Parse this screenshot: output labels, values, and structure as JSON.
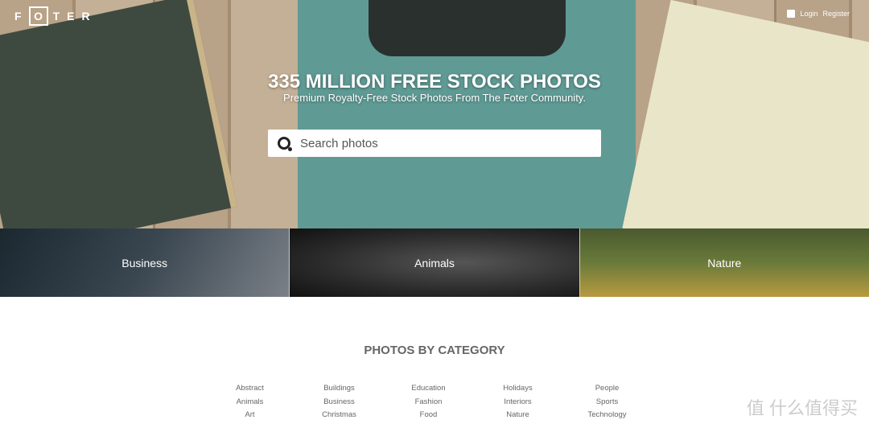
{
  "header": {
    "logo": "FOTER",
    "login": "Login",
    "register": "Register"
  },
  "hero": {
    "title": "335 MILLION FREE STOCK PHOTOS",
    "subtitle": "Premium Royalty-Free Stock Photos From The Foter Community.",
    "search_placeholder": "Search photos"
  },
  "featured": [
    {
      "label": "Business"
    },
    {
      "label": "Animals"
    },
    {
      "label": "Nature"
    }
  ],
  "categories": {
    "title": "PHOTOS BY CATEGORY",
    "items": [
      "Abstract",
      "Buildings",
      "Education",
      "Holidays",
      "People",
      "Animals",
      "Business",
      "Fashion",
      "Interiors",
      "Sports",
      "Art",
      "Christmas",
      "Food",
      "Nature",
      "Technology"
    ]
  },
  "watermark": "值 什么值得买"
}
